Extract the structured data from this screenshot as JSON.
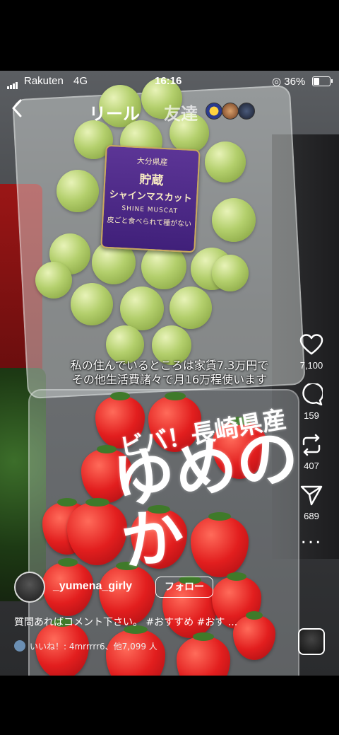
{
  "status_bar": {
    "carrier": "Rakuten",
    "network": "4G",
    "time": "16:16",
    "battery_percent": "36%",
    "battery_level": 0.36
  },
  "nav": {
    "back_icon": "chevron-left-icon",
    "tab_reels": "リール",
    "tab_friends": "友達"
  },
  "photo": {
    "grape_label": {
      "line1": "大分県産",
      "line2": "貯蔵",
      "line3": "シャインマスカット",
      "line4": "SHINE MUSCAT",
      "line5": "皮ごと食べられて種がない"
    },
    "strawberry_label": {
      "line1": "ビバ！長崎県産",
      "line2": "ゆめのか"
    }
  },
  "overlay_caption": {
    "line1": "私の住んでいるところは家賃7.3万円で",
    "line2": "その他生活費諸々で月16万程使います"
  },
  "actions": {
    "like": {
      "icon": "heart-icon",
      "count": "7,100"
    },
    "comment": {
      "icon": "comment-icon",
      "count": "159"
    },
    "remix": {
      "icon": "remix-icon",
      "count": "407"
    },
    "share": {
      "icon": "send-icon",
      "count": "689"
    },
    "more": {
      "icon": "more-icon",
      "label": "..."
    }
  },
  "author": {
    "username": "_yumena_girly",
    "follow_label": "フォロー"
  },
  "caption": "質問あればコメント下さい。 #おすすめ #おす ...",
  "likes_line": "いいね！: 4mrrrrr6、他7,099 人"
}
